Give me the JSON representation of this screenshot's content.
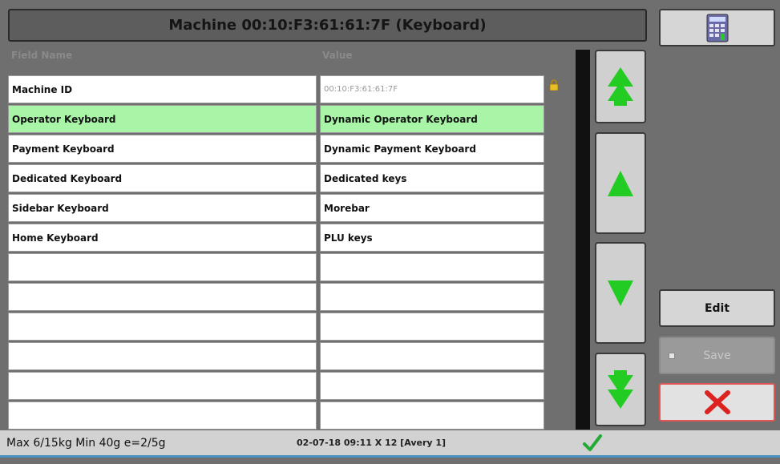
{
  "title": "Machine 00:10:F3:61:61:7F (Keyboard)",
  "columns": {
    "field": "Field Name",
    "value": "Value"
  },
  "rows": [
    {
      "name": "Machine ID",
      "value": "00:10:F3:61:61:7F"
    },
    {
      "name": "Operator Keyboard",
      "value": "Dynamic Operator Keyboard"
    },
    {
      "name": "Payment Keyboard",
      "value": "Dynamic Payment Keyboard"
    },
    {
      "name": "Dedicated Keyboard",
      "value": "Dedicated keys"
    },
    {
      "name": "Sidebar Keyboard",
      "value": "Morebar"
    },
    {
      "name": "Home Keyboard",
      "value": "PLU keys"
    },
    {
      "name": "",
      "value": ""
    },
    {
      "name": "",
      "value": ""
    },
    {
      "name": "",
      "value": ""
    },
    {
      "name": "",
      "value": ""
    },
    {
      "name": "",
      "value": ""
    },
    {
      "name": "",
      "value": ""
    }
  ],
  "selected_row": 1,
  "buttons": {
    "edit": "Edit",
    "save": "Save"
  },
  "status": {
    "weights": "Max 6/15kg Min 40g e=2/5g",
    "datetime": "02-07-18 09:11 X 12 [Avery 1]"
  },
  "colors": {
    "accent_green": "#22cc22",
    "selected_row": "#a8f5a8",
    "cancel_red": "#dd2222"
  }
}
